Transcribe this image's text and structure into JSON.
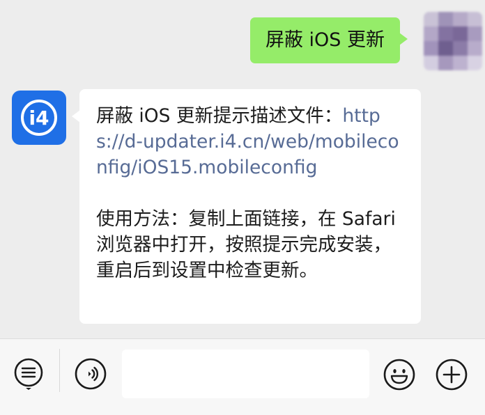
{
  "sent": {
    "text": "屏蔽 iOS 更新"
  },
  "received": {
    "text_prefix": "屏蔽 iOS 更新提示描述文件：",
    "link": "https://d-updater.i4.cn/web/mobileconfig/iOS15.mobileconfig",
    "instructions": "使用方法：复制上面链接，在 Safari 浏览器中打开，按照提示完成安装，重启后到设置中检查更新。"
  },
  "avatars": {
    "self": "avatar-pixelated",
    "sender": "i4-logo-icon",
    "sender_logo_text": "i4"
  },
  "input_bar": {
    "left_icon": "list-menu-icon",
    "voice_icon": "voice-icon",
    "emoji_icon": "emoji-icon",
    "add_icon": "plus-icon",
    "input_value": ""
  },
  "colors": {
    "sent_bubble": "#95ec69",
    "received_bubble": "#ffffff",
    "link": "#576b95",
    "background": "#ededed",
    "i4_blue": "#1f6fe6"
  }
}
